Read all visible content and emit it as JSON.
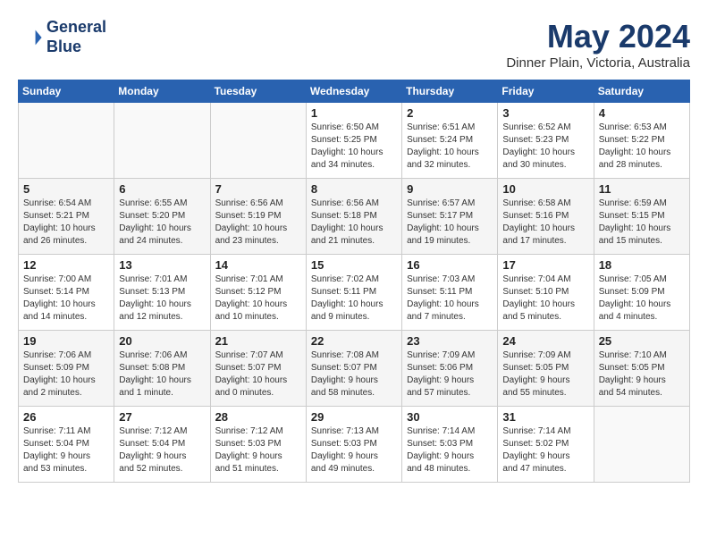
{
  "header": {
    "logo_line1": "General",
    "logo_line2": "Blue",
    "month": "May 2024",
    "location": "Dinner Plain, Victoria, Australia"
  },
  "days_of_week": [
    "Sunday",
    "Monday",
    "Tuesday",
    "Wednesday",
    "Thursday",
    "Friday",
    "Saturday"
  ],
  "weeks": [
    [
      {
        "day": "",
        "info": ""
      },
      {
        "day": "",
        "info": ""
      },
      {
        "day": "",
        "info": ""
      },
      {
        "day": "1",
        "info": "Sunrise: 6:50 AM\nSunset: 5:25 PM\nDaylight: 10 hours\nand 34 minutes."
      },
      {
        "day": "2",
        "info": "Sunrise: 6:51 AM\nSunset: 5:24 PM\nDaylight: 10 hours\nand 32 minutes."
      },
      {
        "day": "3",
        "info": "Sunrise: 6:52 AM\nSunset: 5:23 PM\nDaylight: 10 hours\nand 30 minutes."
      },
      {
        "day": "4",
        "info": "Sunrise: 6:53 AM\nSunset: 5:22 PM\nDaylight: 10 hours\nand 28 minutes."
      }
    ],
    [
      {
        "day": "5",
        "info": "Sunrise: 6:54 AM\nSunset: 5:21 PM\nDaylight: 10 hours\nand 26 minutes."
      },
      {
        "day": "6",
        "info": "Sunrise: 6:55 AM\nSunset: 5:20 PM\nDaylight: 10 hours\nand 24 minutes."
      },
      {
        "day": "7",
        "info": "Sunrise: 6:56 AM\nSunset: 5:19 PM\nDaylight: 10 hours\nand 23 minutes."
      },
      {
        "day": "8",
        "info": "Sunrise: 6:56 AM\nSunset: 5:18 PM\nDaylight: 10 hours\nand 21 minutes."
      },
      {
        "day": "9",
        "info": "Sunrise: 6:57 AM\nSunset: 5:17 PM\nDaylight: 10 hours\nand 19 minutes."
      },
      {
        "day": "10",
        "info": "Sunrise: 6:58 AM\nSunset: 5:16 PM\nDaylight: 10 hours\nand 17 minutes."
      },
      {
        "day": "11",
        "info": "Sunrise: 6:59 AM\nSunset: 5:15 PM\nDaylight: 10 hours\nand 15 minutes."
      }
    ],
    [
      {
        "day": "12",
        "info": "Sunrise: 7:00 AM\nSunset: 5:14 PM\nDaylight: 10 hours\nand 14 minutes."
      },
      {
        "day": "13",
        "info": "Sunrise: 7:01 AM\nSunset: 5:13 PM\nDaylight: 10 hours\nand 12 minutes."
      },
      {
        "day": "14",
        "info": "Sunrise: 7:01 AM\nSunset: 5:12 PM\nDaylight: 10 hours\nand 10 minutes."
      },
      {
        "day": "15",
        "info": "Sunrise: 7:02 AM\nSunset: 5:11 PM\nDaylight: 10 hours\nand 9 minutes."
      },
      {
        "day": "16",
        "info": "Sunrise: 7:03 AM\nSunset: 5:11 PM\nDaylight: 10 hours\nand 7 minutes."
      },
      {
        "day": "17",
        "info": "Sunrise: 7:04 AM\nSunset: 5:10 PM\nDaylight: 10 hours\nand 5 minutes."
      },
      {
        "day": "18",
        "info": "Sunrise: 7:05 AM\nSunset: 5:09 PM\nDaylight: 10 hours\nand 4 minutes."
      }
    ],
    [
      {
        "day": "19",
        "info": "Sunrise: 7:06 AM\nSunset: 5:09 PM\nDaylight: 10 hours\nand 2 minutes."
      },
      {
        "day": "20",
        "info": "Sunrise: 7:06 AM\nSunset: 5:08 PM\nDaylight: 10 hours\nand 1 minute."
      },
      {
        "day": "21",
        "info": "Sunrise: 7:07 AM\nSunset: 5:07 PM\nDaylight: 10 hours\nand 0 minutes."
      },
      {
        "day": "22",
        "info": "Sunrise: 7:08 AM\nSunset: 5:07 PM\nDaylight: 9 hours\nand 58 minutes."
      },
      {
        "day": "23",
        "info": "Sunrise: 7:09 AM\nSunset: 5:06 PM\nDaylight: 9 hours\nand 57 minutes."
      },
      {
        "day": "24",
        "info": "Sunrise: 7:09 AM\nSunset: 5:05 PM\nDaylight: 9 hours\nand 55 minutes."
      },
      {
        "day": "25",
        "info": "Sunrise: 7:10 AM\nSunset: 5:05 PM\nDaylight: 9 hours\nand 54 minutes."
      }
    ],
    [
      {
        "day": "26",
        "info": "Sunrise: 7:11 AM\nSunset: 5:04 PM\nDaylight: 9 hours\nand 53 minutes."
      },
      {
        "day": "27",
        "info": "Sunrise: 7:12 AM\nSunset: 5:04 PM\nDaylight: 9 hours\nand 52 minutes."
      },
      {
        "day": "28",
        "info": "Sunrise: 7:12 AM\nSunset: 5:03 PM\nDaylight: 9 hours\nand 51 minutes."
      },
      {
        "day": "29",
        "info": "Sunrise: 7:13 AM\nSunset: 5:03 PM\nDaylight: 9 hours\nand 49 minutes."
      },
      {
        "day": "30",
        "info": "Sunrise: 7:14 AM\nSunset: 5:03 PM\nDaylight: 9 hours\nand 48 minutes."
      },
      {
        "day": "31",
        "info": "Sunrise: 7:14 AM\nSunset: 5:02 PM\nDaylight: 9 hours\nand 47 minutes."
      },
      {
        "day": "",
        "info": ""
      }
    ]
  ]
}
